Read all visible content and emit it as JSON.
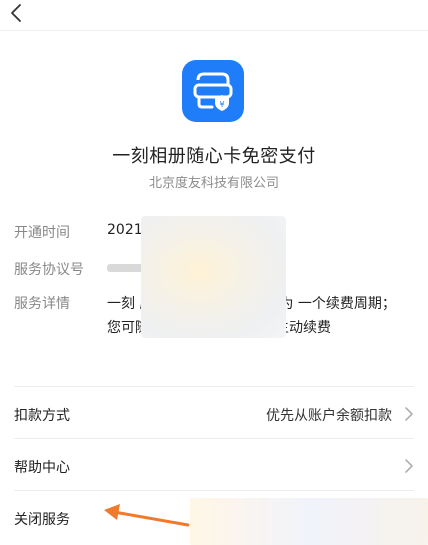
{
  "header": {
    "title": "一刻相册随心卡免密支付",
    "company": "北京度友科技有限公司"
  },
  "info": {
    "open_time_label": "开通时间",
    "open_time_value": "2021",
    "agreement_label": "服务协议号",
    "details_label": "服务详情",
    "details_text": "一刻                                       服务，将在到期前自动为                              一个续费周期；您可随时取消，取消后不再主动续费"
  },
  "list": {
    "payment_label": "扣款方式",
    "payment_value": "优先从账户余额扣款",
    "help_label": "帮助中心",
    "close_label": "关闭服务"
  },
  "colors": {
    "brand": "#1f7dfa",
    "annotation_arrow": "#f07a2b"
  },
  "icons": [
    "back-icon",
    "app-logo-icon",
    "chevron-right-icon"
  ]
}
